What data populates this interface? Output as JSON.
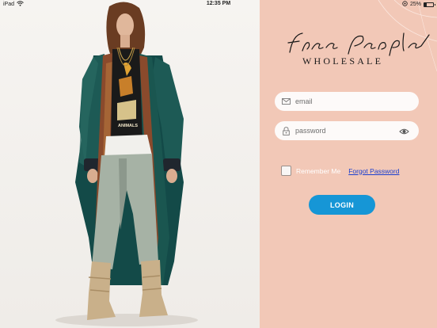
{
  "status_bar": {
    "carrier": "iPad",
    "time": "12:35 PM",
    "battery_text": "25%",
    "battery_level": 0.25
  },
  "photo": {
    "shirt_text": "ANIMALS"
  },
  "brand": {
    "script_name": "Free People",
    "wholesale": "WHOLESALE"
  },
  "login_form": {
    "email_placeholder": "email",
    "password_placeholder": "password",
    "remember_label": "Remember Me",
    "forgot_label": "Forgot Password",
    "login_label": "LOGIN"
  },
  "colors": {
    "panel_bg": "#f2c8b7",
    "button": "#1696d6",
    "link": "#1b3fcf"
  }
}
